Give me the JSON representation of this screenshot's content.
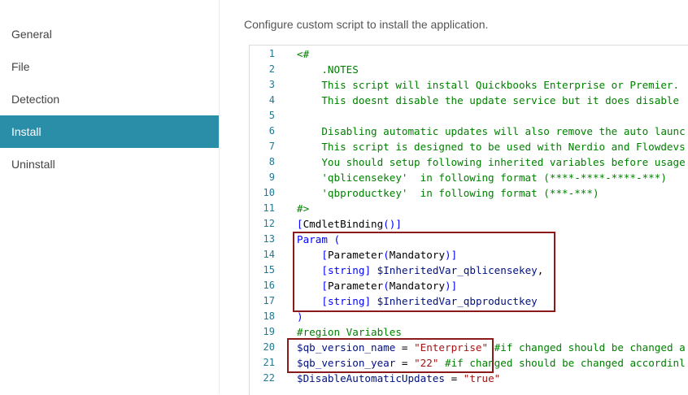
{
  "sidebar": {
    "items": [
      {
        "label": "General"
      },
      {
        "label": "File"
      },
      {
        "label": "Detection"
      },
      {
        "label": "Install"
      },
      {
        "label": "Uninstall"
      }
    ],
    "active": "Install"
  },
  "main": {
    "caption": "Configure custom script to install the application."
  },
  "editor": {
    "lines": [
      "<#",
      "    .NOTES",
      "    This script will install Quickbooks Enterprise or Premier.",
      "    This doesnt disable the update service but it does disable",
      "",
      "    Disabling automatic updates will also remove the auto launc",
      "    This script is designed to be used with Nerdio and Flowdevs",
      "    You should setup following inherited variables before usage",
      "    'qblicensekey'  in following format (****-****-****-***)",
      "    'qbproductkey'  in following format (***-***)",
      "#>",
      "[CmdletBinding()]",
      "Param (",
      "    [Parameter(Mandatory)]",
      "    [string] $InheritedVar_qblicensekey,",
      "    [Parameter(Mandatory)]",
      "    [string] $InheritedVar_qbproductkey",
      ")",
      "#region Variables",
      "$qb_version_name = \"Enterprise\" #if changed should be changed a",
      "$qb_version_year = \"22\" #if changed should be changed accordinl",
      "$DisableAutomaticUpdates = \"true\""
    ]
  },
  "colors": {
    "accent": "#2b8ea9",
    "highlight_box": "#8b1a1a",
    "comment": "#008000",
    "keyword": "#0000ff",
    "variable": "#001080",
    "string": "#a31515",
    "line_number": "#237893"
  }
}
